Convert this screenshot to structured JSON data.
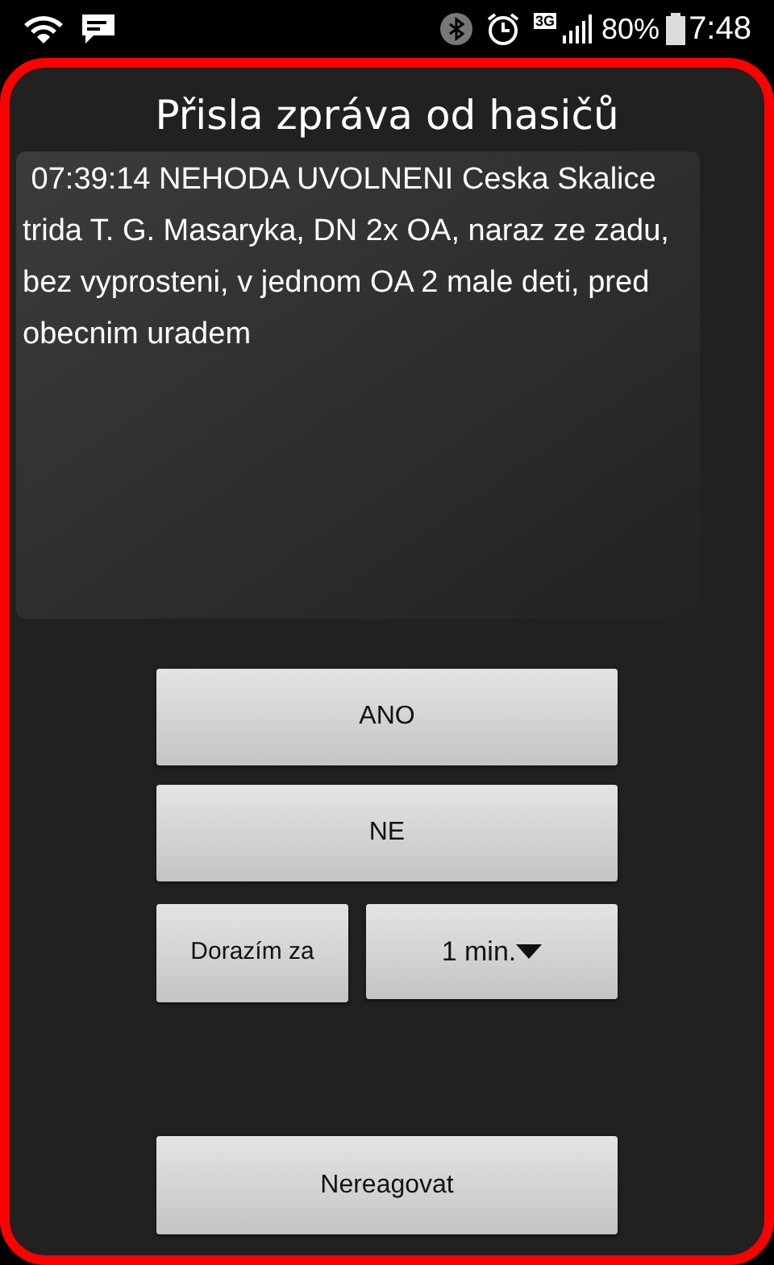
{
  "status_bar": {
    "network_type": "3G",
    "battery_percent": "80%",
    "time": "7:48"
  },
  "dialog": {
    "title": "Přisla zpráva od hasičů",
    "message": " 07:39:14 NEHODA UVOLNENI Ceska Skalice trida T. G. Masaryka, DN 2x OA, naraz ze zadu, bez vyprosteni, v jednom OA 2 male deti, pred obecnim uradem",
    "buttons": [
      {
        "label": "ANO"
      },
      {
        "label": "NE"
      }
    ],
    "arrival": {
      "label": "Dorazím za",
      "dropdown_value": "1 min."
    },
    "dismiss_button": "Nereagovat"
  }
}
